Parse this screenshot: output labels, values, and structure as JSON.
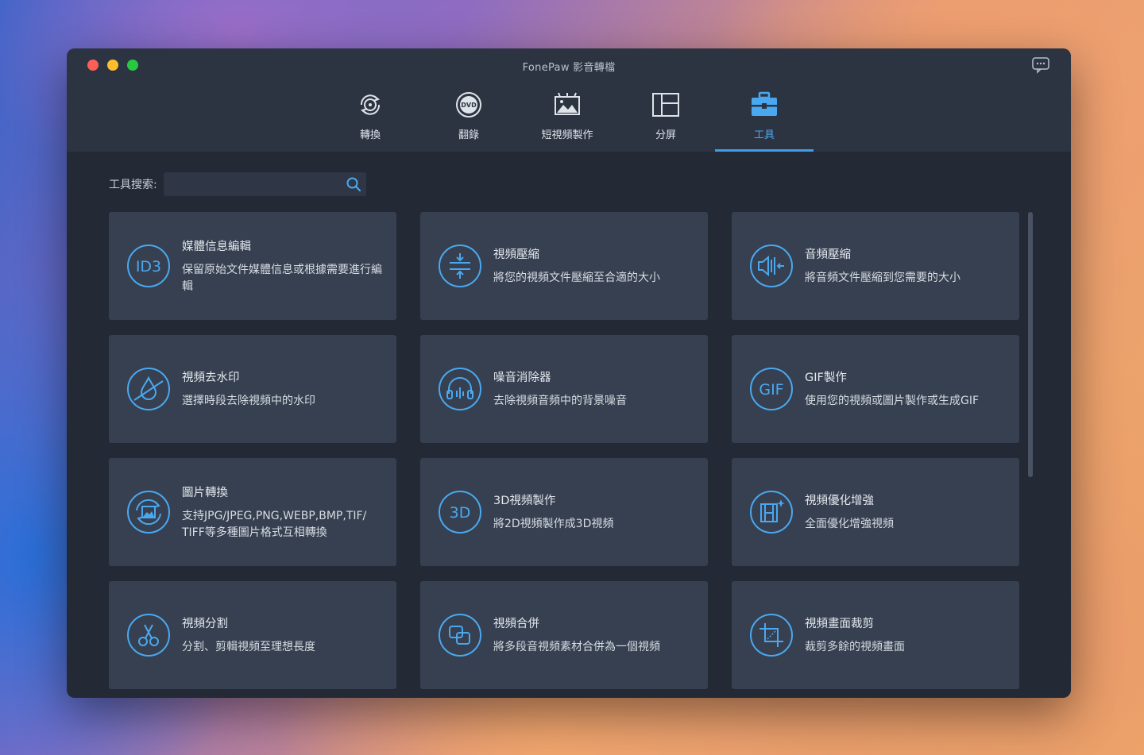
{
  "window": {
    "title": "FonePaw 影音轉檔"
  },
  "tabs": [
    {
      "label": "轉換",
      "icon": "convert-icon",
      "active": false
    },
    {
      "label": "翻錄",
      "icon": "dvd-icon",
      "active": false
    },
    {
      "label": "短視頻製作",
      "icon": "mv-icon",
      "active": false
    },
    {
      "label": "分屏",
      "icon": "collage-icon",
      "active": false
    },
    {
      "label": "工具",
      "icon": "toolbox-icon",
      "active": true
    }
  ],
  "search": {
    "label": "工具搜索:",
    "value": "",
    "placeholder": ""
  },
  "tools": [
    {
      "title": "媒體信息編輯",
      "desc": "保留原始文件媒體信息或根據需要進行編輯",
      "icon": "id3-icon"
    },
    {
      "title": "視頻壓縮",
      "desc": "將您的視頻文件壓縮至合適的大小",
      "icon": "compress-icon"
    },
    {
      "title": "音頻壓縮",
      "desc": "將音頻文件壓縮到您需要的大小",
      "icon": "audio-compress-icon"
    },
    {
      "title": "視頻去水印",
      "desc": "選擇時段去除視頻中的水印",
      "icon": "watermark-remove-icon"
    },
    {
      "title": "噪音消除器",
      "desc": "去除視頻音頻中的背景噪音",
      "icon": "noise-remove-icon"
    },
    {
      "title": "GIF製作",
      "desc": "使用您的視頻或圖片製作或生成GIF",
      "icon": "gif-icon"
    },
    {
      "title": "圖片轉換",
      "desc": "支持JPG/JPEG,PNG,WEBP,BMP,TIF/ TIFF等多種圖片格式互相轉換",
      "icon": "image-convert-icon"
    },
    {
      "title": "3D視頻製作",
      "desc": "將2D視頻製作成3D視頻",
      "icon": "3d-icon"
    },
    {
      "title": "視頻優化增強",
      "desc": "全面優化增強視頻",
      "icon": "enhance-icon"
    },
    {
      "title": "視頻分割",
      "desc": "分割、剪輯視頻至理想長度",
      "icon": "scissors-icon"
    },
    {
      "title": "視頻合併",
      "desc": "將多段音視頻素材合併為一個視頻",
      "icon": "merge-icon"
    },
    {
      "title": "視頻畫面裁剪",
      "desc": "裁剪多餘的視頻畫面",
      "icon": "crop-icon"
    }
  ],
  "colors": {
    "accent": "#4aa8f0",
    "card_bg": "#364050",
    "window_bg": "#232a36",
    "titlebar_bg": "#2c3442"
  }
}
